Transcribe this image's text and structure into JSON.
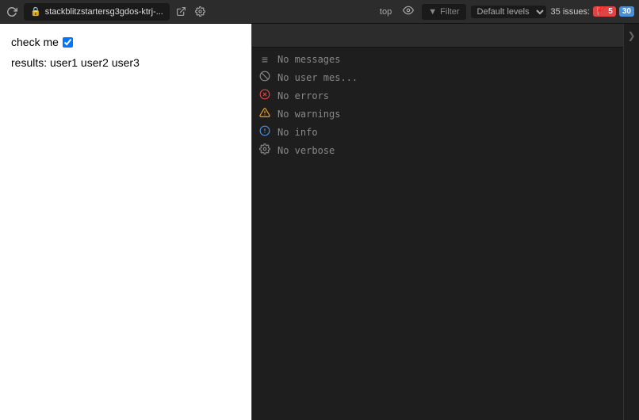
{
  "topbar": {
    "refresh_title": "↻",
    "lock_icon": "🔒",
    "url": "stackblitzstartersg3gdos-ktrj-...",
    "external_icon": "⬡",
    "settings_icon": "⚙",
    "top_icon": "top",
    "eye_icon": "👁",
    "filter_label": "Filter",
    "default_levels_label": "Default levels",
    "issues_label": "35 issues:",
    "badge_red": "🚩 5",
    "badge_blue": "30"
  },
  "preview": {
    "check_label": "check me",
    "results_label": "results: user1 user2 user3"
  },
  "console": {
    "items": [
      {
        "icon": "≡",
        "icon_color": "#888",
        "label": "No messages",
        "type": "messages"
      },
      {
        "icon": "⊘",
        "icon_color": "#888",
        "label": "No user mes...",
        "type": "user-messages"
      },
      {
        "icon": "⊗",
        "icon_color": "#e04343",
        "label": "No errors",
        "type": "errors"
      },
      {
        "icon": "△",
        "icon_color": "#f5a623",
        "label": "No warnings",
        "type": "warnings"
      },
      {
        "icon": "ℹ",
        "icon_color": "#4a90d9",
        "label": "No info",
        "type": "info"
      },
      {
        "icon": "⚙",
        "icon_color": "#888",
        "label": "No verbose",
        "type": "verbose"
      }
    ]
  }
}
